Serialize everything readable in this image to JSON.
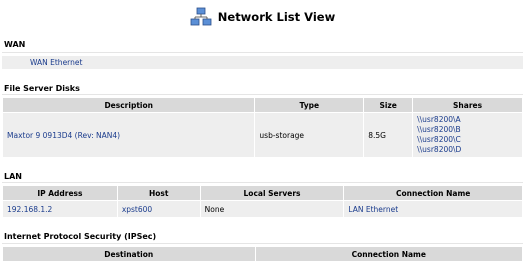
{
  "page": {
    "title": "Network List View",
    "icon": "network-icon"
  },
  "wan": {
    "heading": "WAN",
    "item": "WAN Ethernet"
  },
  "file_server": {
    "heading": "File Server Disks",
    "columns": [
      "Description",
      "Type",
      "Size",
      "Shares"
    ],
    "rows": [
      {
        "description": "Maxtor 9 0913D4 (Rev: NAN4)",
        "type": "usb-storage",
        "size": "8.5G",
        "shares": [
          "\\\\usr8200\\A",
          "\\\\usr8200\\B",
          "\\\\usr8200\\C",
          "\\\\usr8200\\D"
        ]
      }
    ]
  },
  "lan": {
    "heading": "LAN",
    "columns": [
      "IP Address",
      "Host",
      "Local Servers",
      "Connection Name"
    ],
    "rows": [
      {
        "ip": "192.168.1.2",
        "host": "xpst600",
        "local_servers": "None",
        "connection": "LAN Ethernet"
      }
    ]
  },
  "ipsec": {
    "heading": "Internet Protocol Security (IPSec)",
    "columns": [
      "Destination",
      "Connection Name"
    ]
  },
  "colors": {
    "link": "#1a3b8c",
    "header_bg": "#d9d9d9",
    "row_bg": "#eeeeee"
  }
}
